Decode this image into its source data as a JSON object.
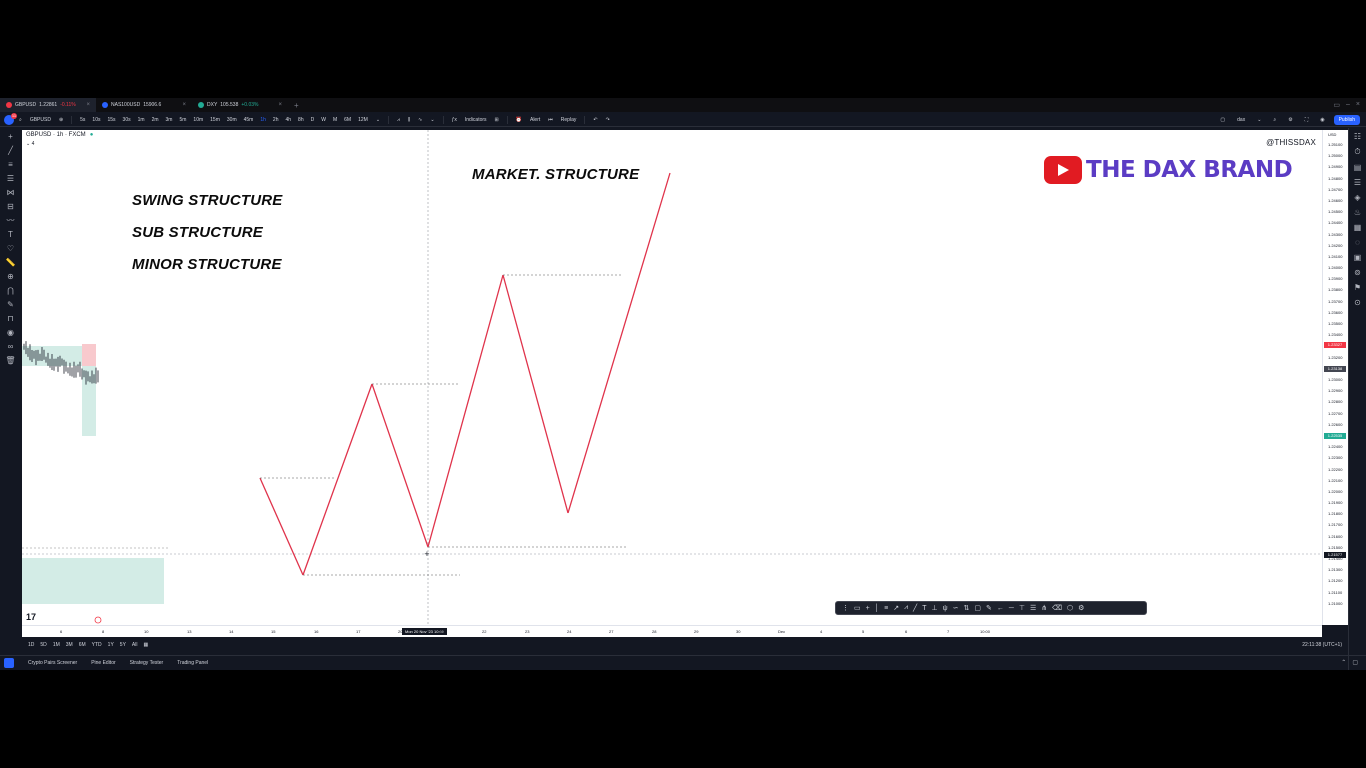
{
  "tabs": [
    {
      "symbol": "GBPUSD",
      "price": "1.22861",
      "change": "-0.11%",
      "up": false
    },
    {
      "symbol": "NAS100USD",
      "price": "15906.6",
      "change": "",
      "up": false
    },
    {
      "symbol": "DXY",
      "price": "105.538",
      "change": "+0.03%",
      "up": true
    }
  ],
  "toolbar": {
    "avatar_badge": "11",
    "symbol": "GBPUSD",
    "intervals": [
      "5s",
      "10s",
      "15s",
      "30s",
      "1m",
      "2m",
      "3m",
      "5m",
      "10m",
      "15m",
      "30m",
      "45m",
      "1h",
      "2h",
      "4h",
      "8h",
      "D",
      "W",
      "M",
      "6M",
      "12M"
    ],
    "active_interval": "1h",
    "indicators_label": "Indicators",
    "alert_label": "Alert",
    "replay_label": "Replay",
    "layout_name": "dax",
    "publish_label": "Publish"
  },
  "chart": {
    "legend_symbol": "GBPUSD · 1h · FXCM",
    "legend_collapse": "⌄ 4",
    "watermark": "@THISSDAX",
    "title": "MARKET.   STRUCTURE",
    "labels": [
      "SWING STRUCTURE",
      "SUB STRUCTURE",
      "MINOR STRUCTURE"
    ],
    "brand_text": "THE DAX BRAND",
    "line_color": "#e0334b",
    "zigzag_legs": [
      "up",
      "down",
      "up",
      "down",
      "up",
      "down",
      "up"
    ]
  },
  "price_axis": {
    "currency": "USD",
    "ticks": [
      "1.25100",
      "1.25000",
      "1.24900",
      "1.24800",
      "1.24700",
      "1.24600",
      "1.24500",
      "1.24400",
      "1.24300",
      "1.24200",
      "1.24100",
      "1.24000",
      "1.23900",
      "1.23800",
      "1.23700",
      "1.23600",
      "1.23500",
      "1.23400",
      "1.23300",
      "1.23200",
      "1.23100",
      "1.23000",
      "1.22900",
      "1.22800",
      "1.22700",
      "1.22600",
      "1.22500",
      "1.22400",
      "1.22300",
      "1.22200",
      "1.22100",
      "1.22000",
      "1.21900",
      "1.21800",
      "1.21700",
      "1.21600",
      "1.21500",
      "1.21400",
      "1.21300",
      "1.21200",
      "1.21100",
      "1.21000"
    ],
    "tag_red": "1.23327",
    "tag_dark": "1.23138",
    "tag_green": "1.22535",
    "tag_cursor": "1.21577",
    "colors": {
      "red": "#f23645",
      "dark": "#434651",
      "green": "#22ab94",
      "cursor": "#131722"
    }
  },
  "time_axis": {
    "ticks": [
      "6",
      "8",
      "10",
      "13",
      "14",
      "15",
      "16",
      "17",
      "20",
      "21",
      "22",
      "23",
      "24",
      "27",
      "28",
      "29",
      "30",
      "Dec",
      "4",
      "5",
      "6",
      "7",
      "10:00"
    ],
    "crosshair_label": "Mon 20 Nov '23  10:00"
  },
  "range_bar": {
    "ranges": [
      "1D",
      "5D",
      "1M",
      "3M",
      "6M",
      "YTD",
      "1Y",
      "5Y",
      "All"
    ],
    "clock": "22:11:38 (UTC+1)"
  },
  "bottom_panels": [
    "Crypto Pairs Screener",
    "Pine Editor",
    "Strategy Tester",
    "Trading Panel"
  ]
}
